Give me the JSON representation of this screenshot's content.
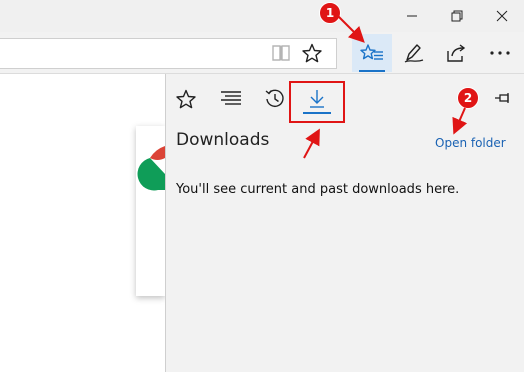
{
  "window": {
    "minimize_icon": "minimize-icon",
    "restore_icon": "restore-icon",
    "close_icon": "close-icon"
  },
  "toolbar": {
    "icons": [
      "reading-view-icon",
      "favorite-star-icon",
      "hub-icon",
      "web-note-icon",
      "share-icon",
      "more-icon"
    ]
  },
  "hub": {
    "tabs": [
      "favorites",
      "reading-list",
      "history",
      "downloads"
    ],
    "active_tab": "downloads",
    "title": "Downloads",
    "open_folder_label": "Open folder",
    "empty_message": "You'll see current and past downloads here."
  },
  "annotations": {
    "badge_1": "1",
    "badge_2": "2",
    "accent": "#e01515"
  },
  "colors": {
    "accent_blue": "#1a73c8",
    "link_blue": "#1a62b3"
  }
}
